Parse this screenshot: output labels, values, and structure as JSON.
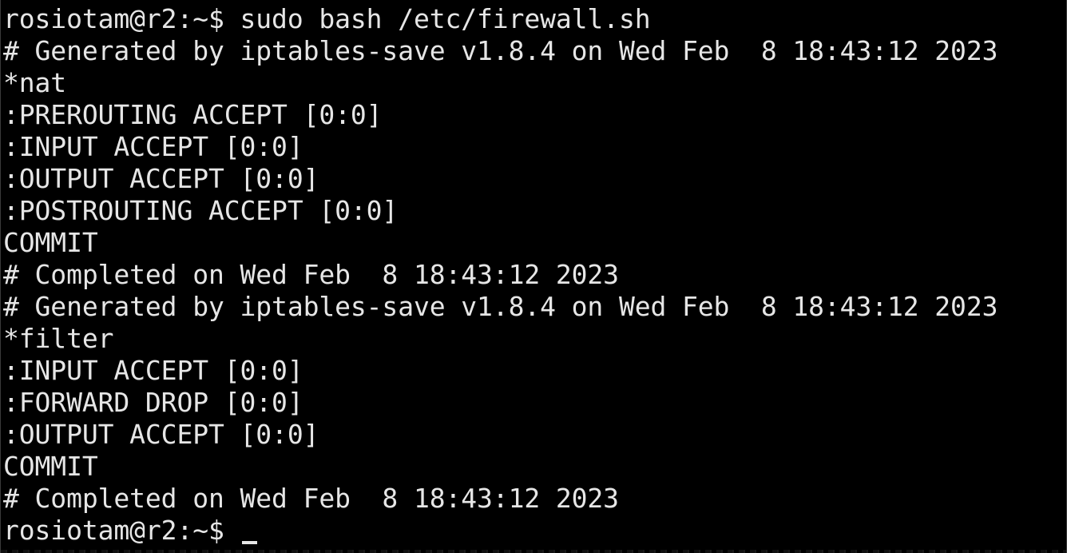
{
  "terminal": {
    "command_line": "rosiotam@r2:~$ sudo bash /etc/firewall.sh",
    "output": [
      "# Generated by iptables-save v1.8.4 on Wed Feb  8 18:43:12 2023",
      "*nat",
      ":PREROUTING ACCEPT [0:0]",
      ":INPUT ACCEPT [0:0]",
      ":OUTPUT ACCEPT [0:0]",
      ":POSTROUTING ACCEPT [0:0]",
      "COMMIT",
      "# Completed on Wed Feb  8 18:43:12 2023",
      "# Generated by iptables-save v1.8.4 on Wed Feb  8 18:43:12 2023",
      "*filter",
      ":INPUT ACCEPT [0:0]",
      ":FORWARD DROP [0:0]",
      ":OUTPUT ACCEPT [0:0]",
      "COMMIT",
      "# Completed on Wed Feb  8 18:43:12 2023"
    ],
    "prompt": "rosiotam@r2:~$ "
  },
  "colors": {
    "background": "#000000",
    "foreground": "#e6e6e6"
  }
}
